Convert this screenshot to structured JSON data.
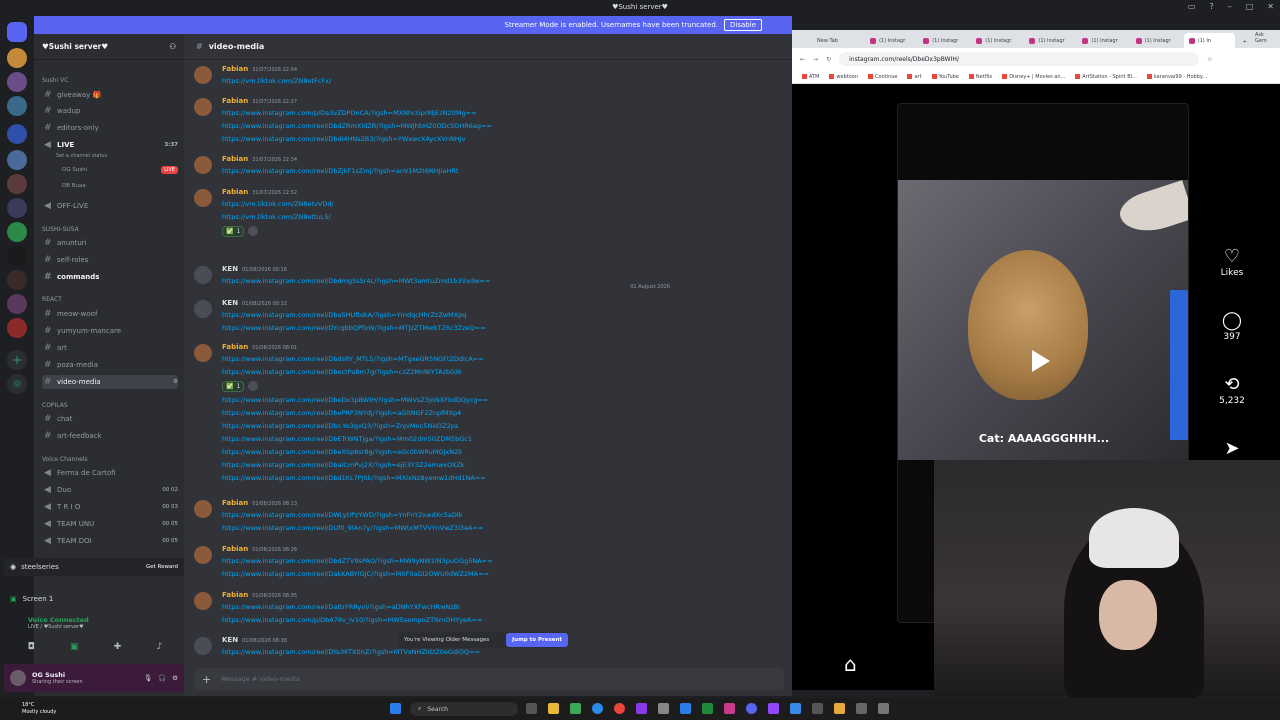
{
  "window": {
    "title": "♥Sushi server♥"
  },
  "banner": {
    "text": "Streamer Mode is enabled. Usernames have been truncated.",
    "disable_label": "Disable"
  },
  "sidebar": {
    "server_name": "♥Sushi server♥",
    "categories": {
      "sushi_vc": "Sushi VC",
      "sushi_susa": "SUSHI-SUSA",
      "react": "REACT",
      "copilas": "COPILAS",
      "voice_channels": "Voice Channels"
    },
    "channels": {
      "giveaway": "giveaway 🎁",
      "wadup": "wadup",
      "editors_only": "editors-only",
      "live": "LIVE",
      "live_status": "Set a channel status",
      "live_time": "3:37",
      "live_badge": "LIVE",
      "live_user1": "OG Sushi",
      "live_user2": "DB Buaa",
      "off_live": "OFF-LIVE",
      "anunturi": "anunturi",
      "self_roles": "self-roles",
      "commands": "commands",
      "meow_woof": "meow-woof",
      "yumyum": "yumyum-mancare",
      "art": "art",
      "poza_media": "poza-media",
      "video_media": "video-media",
      "chat": "chat",
      "art_feedback": "art-feedback",
      "ferma": "Ferma de Cartofi",
      "duo": "Duo",
      "trio": "T R I O",
      "team_unu": "TEAM UNU",
      "team_doi": "TEAM DOI",
      "duo_count": "00 02",
      "trio_count": "00 03",
      "unu_count": "00 05",
      "doi_count": "00 05"
    }
  },
  "promo": {
    "brand": "steelseries",
    "button": "Get Reward"
  },
  "stream": {
    "label": "Screen 1"
  },
  "voice": {
    "status": "Voice Connected",
    "channel": "LIVE / ♥Sushi server♥"
  },
  "user": {
    "name": "OG Sushi",
    "status": "Sharing their screen"
  },
  "chat": {
    "channel": "video-media",
    "divider_date": "01 August 2026",
    "messages": [
      {
        "author": "Fabian",
        "ts": "31/07/2026 22:04",
        "links": [
          "https://vm.tiktok.com/ZN8etFcFx/"
        ]
      },
      {
        "author": "Fabian",
        "ts": "31/07/2026 22:27",
        "links": [
          "https://www.instagram.com/p/Da3vZDPDnCA/?igsh=MXNhcGprMjEzN2tIMg==",
          "https://www.instagram.com/reel/DbdZRmXldZR/?igsh=MWJhbHZ0ODc5OHR6ag==",
          "https://www.instagram.com/reel/Dbdi4HNs2B3/?igsh=YWxwcXAycXVnNHJv"
        ]
      },
      {
        "author": "Fabian",
        "ts": "31/07/2026 22:34",
        "links": [
          "https://www.instagram.com/reel/DbZjkF1sZmj/?igsh=anV1M2t6NHJiaHRt"
        ]
      },
      {
        "author": "Fabian",
        "ts": "31/07/2026 22:52",
        "links": [
          "https://vm.tiktok.com/ZN8etvVDd/",
          "https://vm.tiktok.com/ZN8ettuL5/"
        ],
        "reaction": "1"
      },
      {
        "author": "KEN",
        "ts": "01/08/2026 00:16",
        "links": [
          "https://www.instagram.com/reel/DbdmgSsSr4L/?igsh=MWt3amtuZmd1b3Vxdw=="
        ]
      },
      {
        "author": "KEN",
        "ts": "01/08/2026 00:32",
        "links": [
          "https://www.instagram.com/reel/DbaSHUftokA/?igsh=YmdqcHhrZzZwMXpq",
          "https://www.instagram.com/reel/DYcqbbQPfxW/?igsh=MTJzZTMwbTZ6c3ZzeQ=="
        ]
      },
      {
        "author": "Fabian",
        "ts": "01/08/2026 08:01",
        "links": [
          "https://www.instagram.com/reel/DbdsRY_MTL5/?igsh=MTgxeGR5NGFtZDdicA==",
          "https://www.instagram.com/reel/DbectPaBm7g/?igsh=czZ2MnNiYTAzbGl6"
        ],
        "reaction": "1"
      },
      {
        "author": "",
        "ts": "",
        "links": [
          "https://www.instagram.com/reel/DbeDx3pBWIH/?igsh=MWVsZ3JoNXFkdDQycg==",
          "https://www.instagram.com/reel/DbePRP3NYdj/?igsh=aGltNGF2ZnplMXp4",
          "https://www.instagram.com/reel/Dbc-Yo3gxQ3/?igsh=ZnJvMnc5Nid3Z2ps",
          "https://www.instagram.com/reel/DbETrWNTjga/?igsh=Mm02dm50ZDM5bGc1",
          "https://www.instagram.com/reel/DbeXSp8sr8g/?igsh=eGc0bWRuMGJxN2li",
          "https://www.instagram.com/reel/DbaICmPvj2X/?igsh=ejE3Y3Z2emwxOXZk",
          "https://www.instagram.com/reel/Dbd1KL7PJSk/?igsh=MXIxNzByemw1dHd1NA=="
        ]
      },
      {
        "author": "Fabian",
        "ts": "01/08/2026 08:13",
        "links": [
          "https://www.instagram.com/reel/DWLytIPzYWD/?igsh=YnFnY2xwdXc5aDlk",
          "https://www.instagram.com/reel/DUf0_9lAn7y/?igsh=MWtxMTVVYnVwZ3l3eA=="
        ]
      },
      {
        "author": "Fabian",
        "ts": "01/08/2026 08:26",
        "links": [
          "https://www.instagram.com/reel/DbdZTV9sPAO/?igsh=MW9yNW1lN3puOGg5NA==",
          "https://www.instagram.com/reel/DakKABYlGJC/?igsh=MXF0aGl2OWU0dWZ2MA=="
        ]
      },
      {
        "author": "Fabian",
        "ts": "01/08/2026 08:35",
        "links": [
          "https://www.instagram.com/reel/DattrFRRyvI/?igsh=aDNhYXFwcHRwNzBi",
          "https://www.instagram.com/p/DbA78v_Iv10/?igsh=MW5sempoZTNmOHYyeA=="
        ]
      },
      {
        "author": "KEN",
        "ts": "01/08/2026 08:38",
        "links": [
          "https://www.instagram.com/reel/DYa3KTXtlnZ/?igsh=MTVxNHZldzZ0eGdiOQ=="
        ]
      }
    ],
    "older_text": "You're Viewing Older Messages",
    "jump_label": "Jump to Present",
    "input_placeholder": "Message # video-media"
  },
  "browser": {
    "tabs": [
      "New Tab",
      "(1) Instagr",
      "(1) Instagr",
      "(1) Instagr",
      "(1) Instagr",
      "(1) Instagr",
      "(1) Instagr",
      "(1) In"
    ],
    "ask": "Ask Gem",
    "url": "instagram.com/reels/DbeDx3pBWIH/",
    "bookmarks": [
      "ATM",
      "webtoon",
      "Continue",
      "art",
      "YouTube",
      "Netflix",
      "Disney+ | Movies an...",
      "ArtStation - Spirit Bl...",
      "karanvai99 - Hobby..."
    ]
  },
  "reel": {
    "caption": "Cat: AAAAGGGHHH...",
    "likes_label": "Likes",
    "comments": "397",
    "reposts": "5,232"
  },
  "taskbar": {
    "temp": "18°C",
    "weather": "Mostly cloudy",
    "search": "Search"
  },
  "colors": {
    "accent": "#5865f2",
    "link": "#00a8fc",
    "author": "#f0b232"
  }
}
